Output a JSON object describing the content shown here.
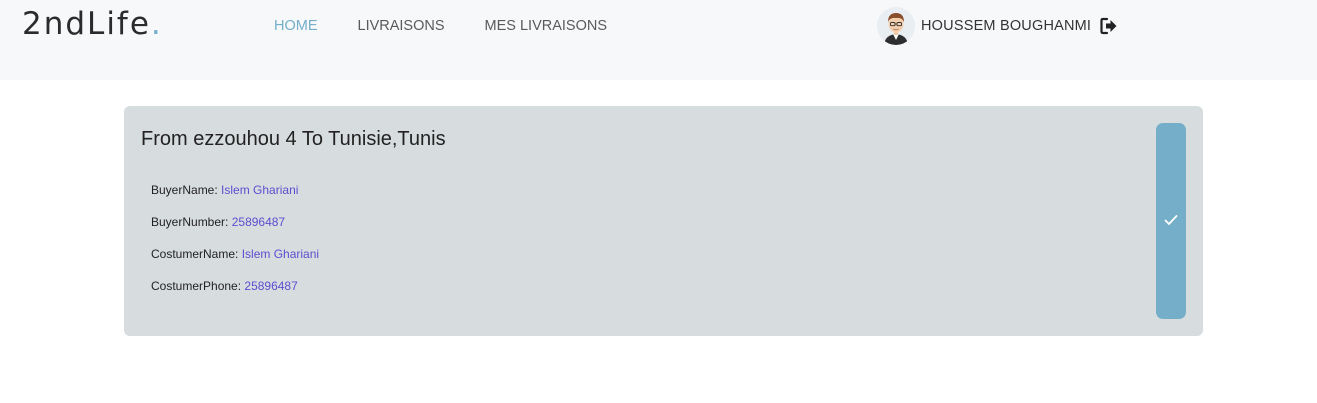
{
  "brand": {
    "name": "2ndLife",
    "dot": "."
  },
  "nav": {
    "items": [
      {
        "label": "HOME",
        "active": true
      },
      {
        "label": "LIVRAISONS",
        "active": false
      },
      {
        "label": "MES LIVRAISONS",
        "active": false
      }
    ]
  },
  "user": {
    "name": "HOUSSEM BOUGHANMI",
    "avatar_icon": "user-avatar-icon",
    "logout_icon": "sign-out-icon"
  },
  "delivery": {
    "title": "From ezzouhou 4 To Tunisie,Tunis",
    "fields": [
      {
        "label": "BuyerName:",
        "value": "Islem Ghariani"
      },
      {
        "label": "BuyerNumber:",
        "value": "25896487"
      },
      {
        "label": "CostumerName:",
        "value": "Islem Ghariani"
      },
      {
        "label": "CostumerPhone:",
        "value": "25896487"
      }
    ],
    "confirm_icon": "check-icon"
  },
  "colors": {
    "accent": "#74aec9",
    "card_bg": "#d7dcdf",
    "navbar_bg": "#f7f8fa",
    "value_text": "#5b4fcf"
  }
}
